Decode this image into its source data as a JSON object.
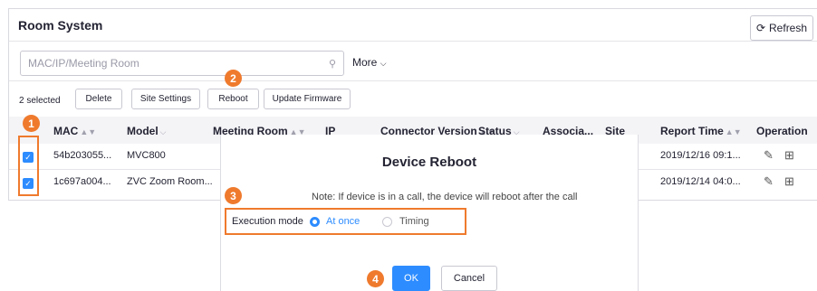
{
  "header": {
    "title": "Room System",
    "refresh_label": "Refresh",
    "refresh_icon": "refresh-icon"
  },
  "search": {
    "placeholder": "MAC/IP/Meeting Room",
    "more_label": "More"
  },
  "selection_toolbar": {
    "selected_count": "2 selected",
    "buttons": [
      "Delete",
      "Site Settings",
      "Reboot",
      "Update Firmware"
    ]
  },
  "table": {
    "columns": [
      "MAC",
      "Model",
      "Meeting Room",
      "IP",
      "Connector Version",
      "Status",
      "Associa...",
      "Site",
      "Report Time",
      "Operation"
    ],
    "rows": [
      {
        "checked": true,
        "mac": "54b203055...",
        "model": "MVC800",
        "report_time": "2019/12/16 09:1..."
      },
      {
        "checked": true,
        "mac": "1c697a004...",
        "model": "ZVC Zoom Room...",
        "report_time": "2019/12/14 04:0..."
      }
    ]
  },
  "dialog": {
    "title": "Device Reboot",
    "note": "Note: If device is in a call, the device will reboot after the call",
    "execution_mode_label": "Execution mode",
    "options": [
      {
        "label": "At once",
        "selected": true
      },
      {
        "label": "Timing",
        "selected": false
      }
    ],
    "ok_label": "OK",
    "cancel_label": "Cancel"
  },
  "callouts": [
    "1",
    "2",
    "3",
    "4"
  ],
  "colors": {
    "accent": "#2d8cff",
    "callout": "#ef7a2d",
    "header_bg": "#f4f4f7"
  }
}
